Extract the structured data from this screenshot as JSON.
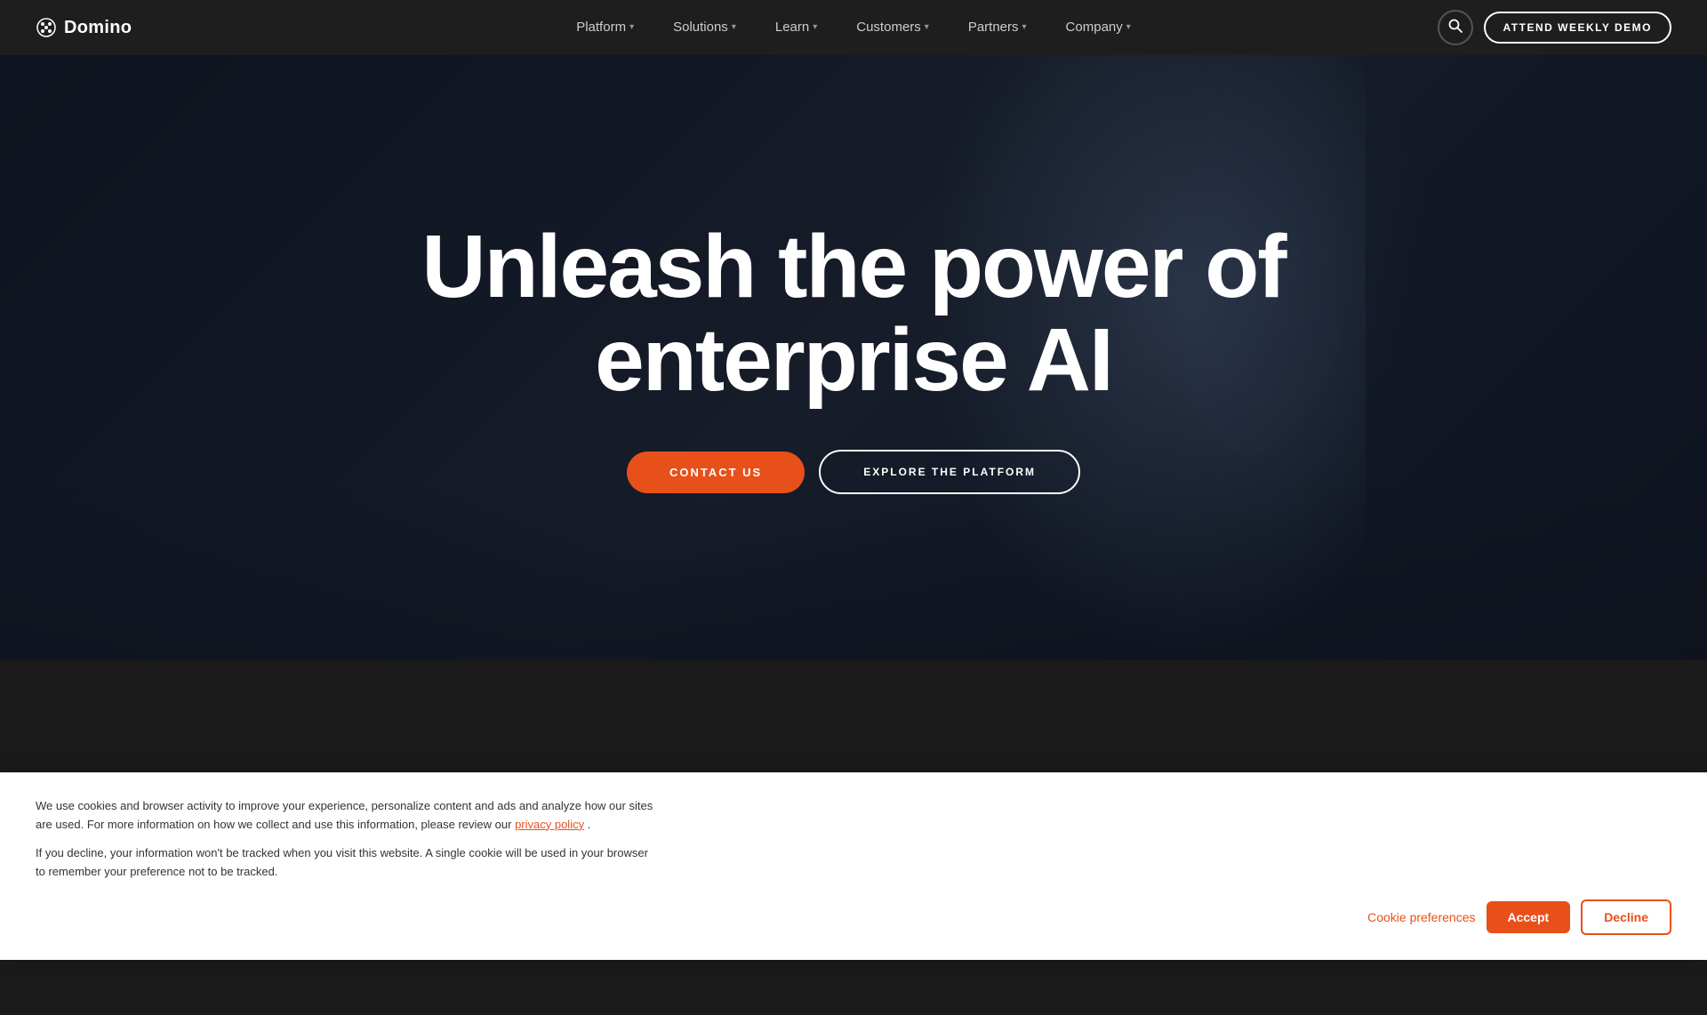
{
  "brand": {
    "logo_text": "Domino",
    "logo_icon": "✳"
  },
  "nav": {
    "items": [
      {
        "label": "Platform",
        "has_arrow": true
      },
      {
        "label": "Solutions",
        "has_arrow": true
      },
      {
        "label": "Learn",
        "has_arrow": true
      },
      {
        "label": "Customers",
        "has_arrow": true
      },
      {
        "label": "Partners",
        "has_arrow": true
      },
      {
        "label": "Company",
        "has_arrow": true
      }
    ],
    "search_icon": "🔍",
    "demo_button": "ATTEND WEEKLY DEMO"
  },
  "hero": {
    "title_line1": "Unleash the power of",
    "title_line2": "enterprise AI",
    "contact_button": "CONTACT US",
    "explore_button": "EXPLORE THE PLATFORM"
  },
  "cookie": {
    "text1": "We use cookies and browser activity to improve your experience, personalize content and ads and analyze how our sites are used. For more information on how we collect and use this information, please review our",
    "privacy_link": "privacy policy",
    "text1_end": ".",
    "text2": "If you decline, your information won't be tracked when you visit this website. A single cookie will be used in your browser to remember your preference not to be tracked.",
    "preferences_label": "Cookie preferences",
    "accept_label": "Accept",
    "decline_label": "Decline"
  }
}
